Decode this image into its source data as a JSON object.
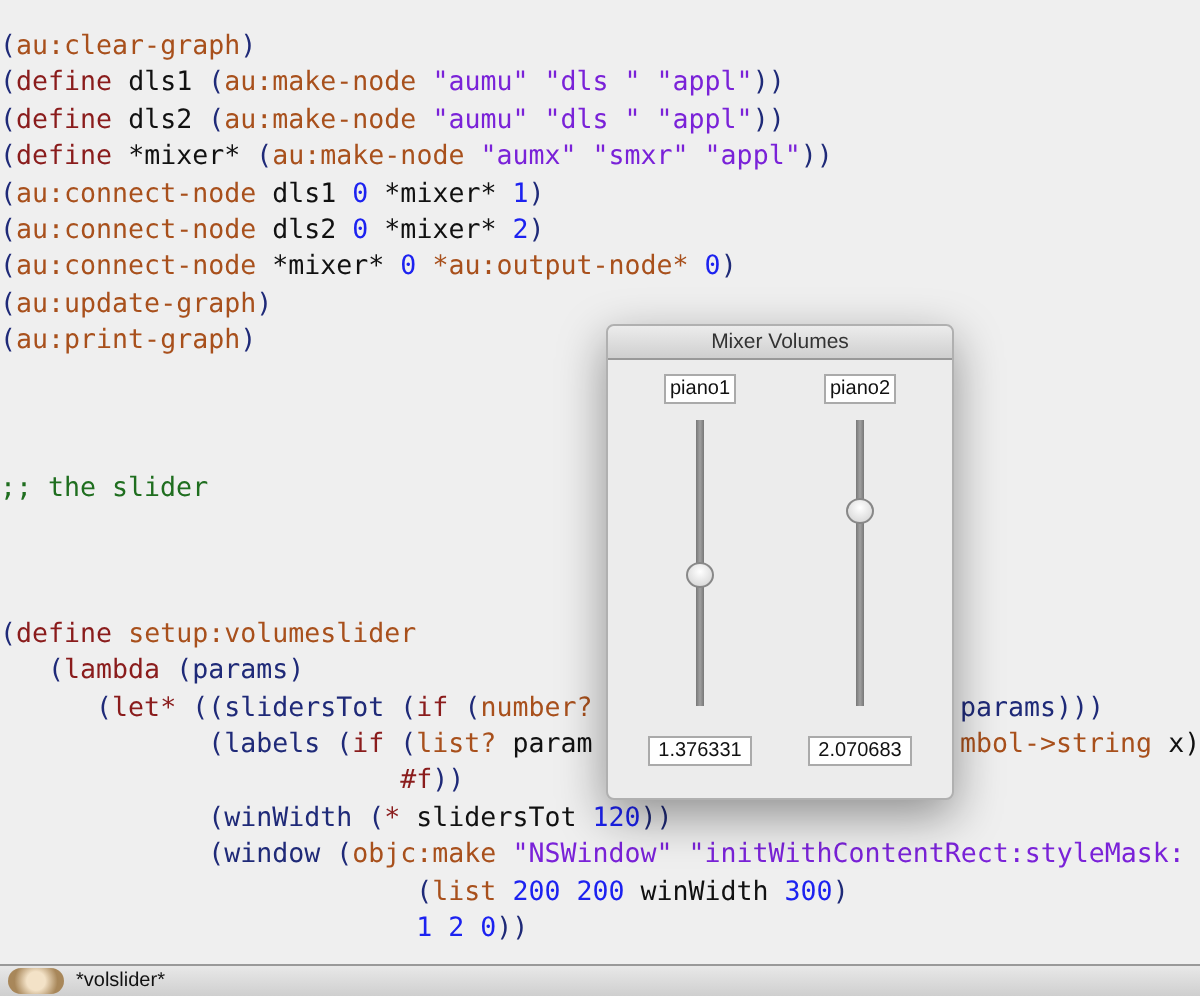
{
  "editor": {
    "blocks": [
      {
        "lines": [
          {
            "tokens": [
              {
                "kind": "paren",
                "t": "("
              },
              {
                "kind": "function",
                "t": "au:clear-graph"
              },
              {
                "kind": "paren",
                "t": ")"
              }
            ]
          },
          {
            "tokens": [
              {
                "kind": "paren",
                "t": "("
              },
              {
                "kind": "keyword",
                "t": "define"
              },
              {
                "kind": "plain",
                "t": " dls1 "
              },
              {
                "kind": "paren",
                "t": "("
              },
              {
                "kind": "function",
                "t": "au:make-node"
              },
              {
                "kind": "string",
                "t": " \"aumu\" \"dls \" \"appl\""
              },
              {
                "kind": "paren",
                "t": "))"
              }
            ]
          },
          {
            "tokens": [
              {
                "kind": "paren",
                "t": "("
              },
              {
                "kind": "keyword",
                "t": "define"
              },
              {
                "kind": "plain",
                "t": " dls2 "
              },
              {
                "kind": "paren",
                "t": "("
              },
              {
                "kind": "function",
                "t": "au:make-node"
              },
              {
                "kind": "string",
                "t": " \"aumu\" \"dls \" \"appl\""
              },
              {
                "kind": "paren",
                "t": "))"
              }
            ]
          },
          {
            "tokens": [
              {
                "kind": "paren",
                "t": "("
              },
              {
                "kind": "keyword",
                "t": "define"
              },
              {
                "kind": "plain",
                "t": " *mixer* "
              },
              {
                "kind": "paren",
                "t": "("
              },
              {
                "kind": "function",
                "t": "au:make-node"
              },
              {
                "kind": "string",
                "t": " \"aumx\" \"smxr\" \"appl\""
              },
              {
                "kind": "paren",
                "t": "))"
              }
            ]
          },
          {
            "tokens": [
              {
                "kind": "paren",
                "t": "("
              },
              {
                "kind": "function",
                "t": "au:connect-node"
              },
              {
                "kind": "plain",
                "t": " dls1 "
              },
              {
                "kind": "number",
                "t": "0"
              },
              {
                "kind": "plain",
                "t": " *mixer* "
              },
              {
                "kind": "number",
                "t": "1"
              },
              {
                "kind": "paren",
                "t": ")"
              }
            ]
          },
          {
            "tokens": [
              {
                "kind": "paren",
                "t": "("
              },
              {
                "kind": "function",
                "t": "au:connect-node"
              },
              {
                "kind": "plain",
                "t": " dls2 "
              },
              {
                "kind": "number",
                "t": "0"
              },
              {
                "kind": "plain",
                "t": " *mixer* "
              },
              {
                "kind": "number",
                "t": "2"
              },
              {
                "kind": "paren",
                "t": ")"
              }
            ]
          },
          {
            "tokens": [
              {
                "kind": "paren",
                "t": "("
              },
              {
                "kind": "function",
                "t": "au:connect-node"
              },
              {
                "kind": "plain",
                "t": " *mixer* "
              },
              {
                "kind": "number",
                "t": "0"
              },
              {
                "kind": "function",
                "t": " *au:output-node* "
              },
              {
                "kind": "number",
                "t": "0"
              },
              {
                "kind": "paren",
                "t": ")"
              }
            ]
          },
          {
            "tokens": [
              {
                "kind": "paren",
                "t": "("
              },
              {
                "kind": "function",
                "t": "au:update-graph"
              },
              {
                "kind": "paren",
                "t": ")"
              }
            ]
          },
          {
            "tokens": [
              {
                "kind": "paren",
                "t": "("
              },
              {
                "kind": "function",
                "t": "au:print-graph"
              },
              {
                "kind": "paren",
                "t": ")"
              }
            ]
          }
        ]
      },
      {
        "lines": [
          {
            "tokens": [
              {
                "kind": "comment",
                "t": ";; the slider"
              }
            ]
          }
        ]
      },
      {
        "lines": [
          {
            "tokens": [
              {
                "kind": "paren",
                "t": "("
              },
              {
                "kind": "keyword",
                "t": "define"
              },
              {
                "kind": "function",
                "t": " setup:volumeslider"
              }
            ]
          },
          {
            "tokens": [
              {
                "kind": "paren",
                "t": "   ("
              },
              {
                "kind": "keyword",
                "t": "lambda"
              },
              {
                "kind": "paren",
                "t": " (params)"
              }
            ]
          },
          {
            "tokens": [
              {
                "kind": "paren",
                "t": "      ("
              },
              {
                "kind": "keyword",
                "t": "let*"
              },
              {
                "kind": "paren",
                "t": " ((slidersTot ("
              },
              {
                "kind": "keyword",
                "t": "if"
              },
              {
                "kind": "paren",
                "t": " ("
              },
              {
                "kind": "function",
                "t": "number?"
              }
            ],
            "tail": [
              {
                "kind": "paren",
                "t": "params)))"
              }
            ]
          },
          {
            "tokens": [
              {
                "kind": "paren",
                "t": "             (labels ("
              },
              {
                "kind": "keyword",
                "t": "if"
              },
              {
                "kind": "paren",
                "t": " ("
              },
              {
                "kind": "function",
                "t": "list?"
              },
              {
                "kind": "plain",
                "t": " param"
              }
            ],
            "tail": [
              {
                "kind": "function",
                "t": "mbol->string"
              },
              {
                "kind": "plain",
                "t": " x)"
              }
            ]
          },
          {
            "tokens": [
              {
                "kind": "keyword",
                "t": "                         #f"
              },
              {
                "kind": "paren",
                "t": "))"
              }
            ]
          },
          {
            "tokens": [
              {
                "kind": "paren",
                "t": "             (winWidth ("
              },
              {
                "kind": "keyword",
                "t": "*"
              },
              {
                "kind": "plain",
                "t": " slidersTot "
              },
              {
                "kind": "number",
                "t": "120"
              },
              {
                "kind": "paren",
                "t": "))"
              }
            ]
          },
          {
            "tokens": [
              {
                "kind": "paren",
                "t": "             (window ("
              },
              {
                "kind": "function",
                "t": "objc:make"
              },
              {
                "kind": "string",
                "t": " \"NSWindow\" \"initWithContentRect:styleMask:"
              }
            ]
          },
          {
            "tokens": [
              {
                "kind": "paren",
                "t": "                          ("
              },
              {
                "kind": "function",
                "t": "list"
              },
              {
                "kind": "number",
                "t": " 200 200"
              },
              {
                "kind": "plain",
                "t": " winWidth "
              },
              {
                "kind": "number",
                "t": "300"
              },
              {
                "kind": "paren",
                "t": ")"
              }
            ]
          },
          {
            "tokens": [
              {
                "kind": "number",
                "t": "                          1 2 0"
              },
              {
                "kind": "paren",
                "t": "))"
              }
            ]
          }
        ]
      }
    ]
  },
  "dialog": {
    "title": "Mixer Volumes",
    "sliders": [
      {
        "label": "piano1",
        "level": 0.46,
        "value": "1.376331"
      },
      {
        "label": "piano2",
        "level": 0.68,
        "value": "2.070683"
      }
    ]
  },
  "status_bar": {
    "buffer": "*volslider*"
  }
}
